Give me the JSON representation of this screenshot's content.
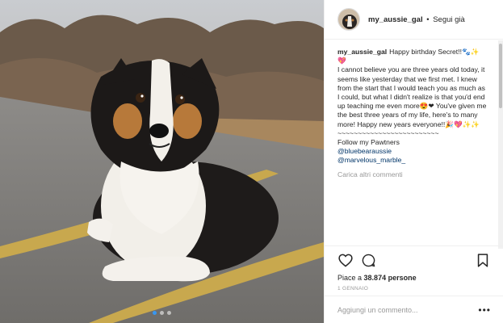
{
  "post": {
    "image_alt": "Australian shepherd dog lying on a road",
    "carousel": {
      "count": 3,
      "active": 1
    }
  },
  "header": {
    "username": "my_aussie_gal",
    "separator": "•",
    "follow_label": "Segui già"
  },
  "caption": {
    "username": "my_aussie_gal",
    "title": "Happy birthday Secret!!🐾✨💖",
    "body": "I cannot believe you are three years old today, it seems like yesterday that we first met. I knew from the start that I would teach you as much as I could, but what I didn't realize is that you'd end up teaching me even more😍❤ You've given me the best three years of my life, here's to many more! Happy new years everyone!!🎉💖✨✨",
    "divider": "~~~~~~~~~~~~~~~~~~~~~~~~~",
    "follow_text": "Follow my Pawtners",
    "tags": [
      "@bluebearaussie",
      "@marvelous_marble_"
    ]
  },
  "load_more_label": "Carica altri commenti",
  "actions": {
    "like_icon": "heart-icon",
    "comment_icon": "comment-icon",
    "save_icon": "bookmark-icon"
  },
  "likes": {
    "prefix": "Piace a",
    "count": "38.874",
    "suffix": "persone"
  },
  "date_label": "1 GENNAIO",
  "comment_box": {
    "placeholder": "Aggiungi un commento...",
    "more_label": "•••"
  },
  "colors": {
    "link": "#003569",
    "muted": "#999999",
    "text": "#262626",
    "border": "#efefef"
  }
}
